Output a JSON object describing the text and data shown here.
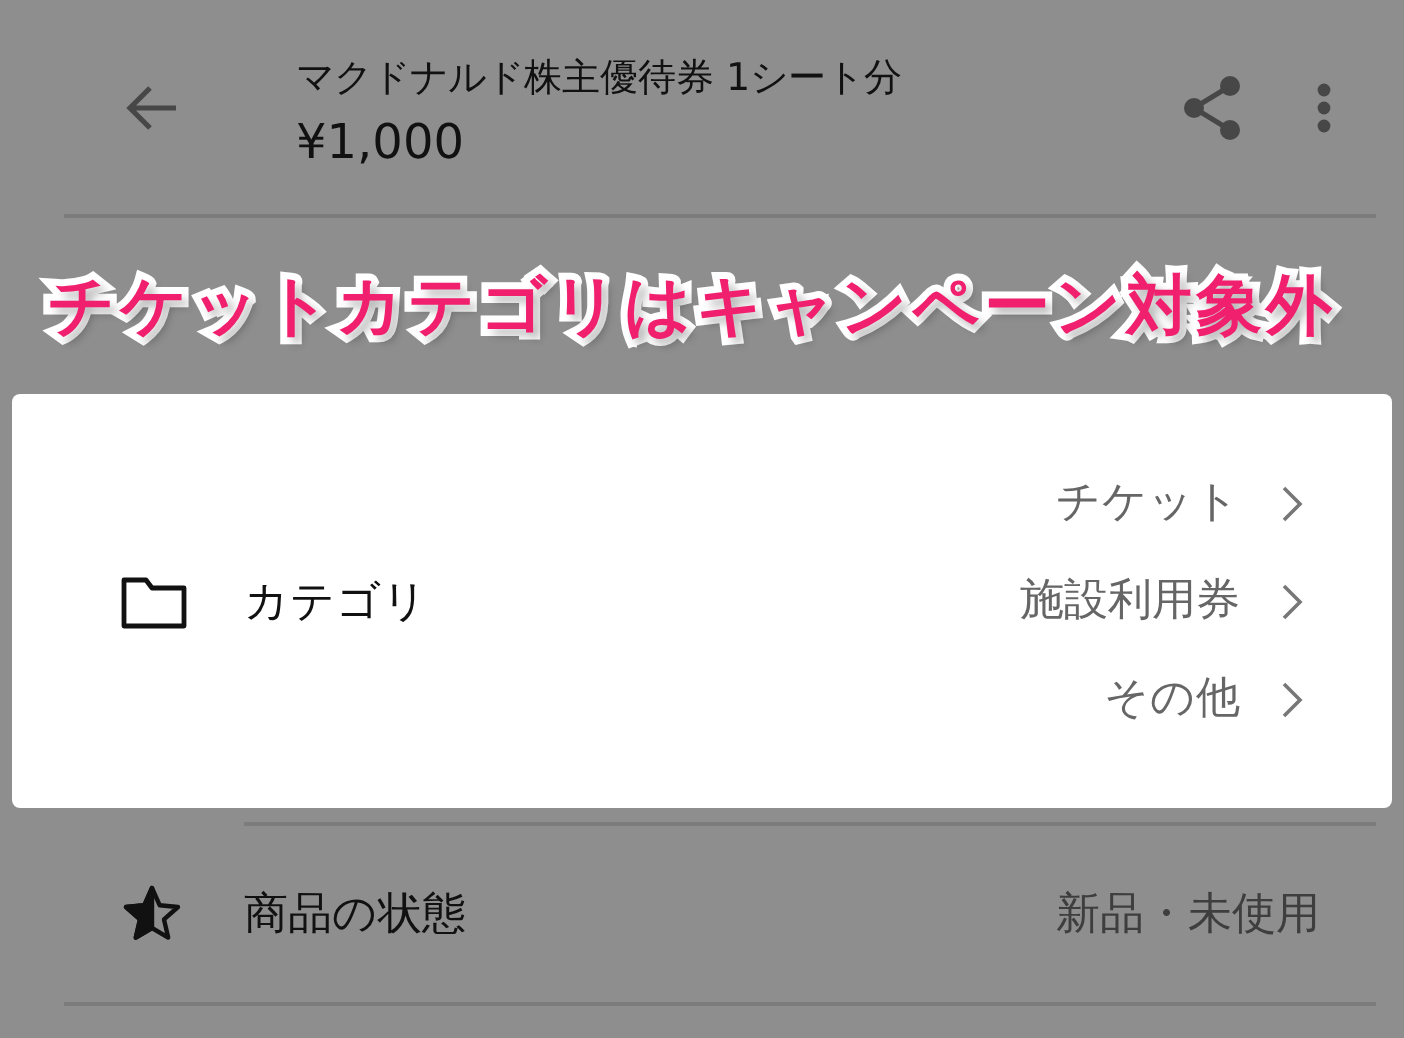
{
  "header": {
    "title": "マクドナルド株主優待券 1シート分",
    "price": "¥1,000"
  },
  "annotation": "チケットカテゴリはキャンペーン対象外",
  "category": {
    "label": "カテゴリ",
    "path": [
      "チケット",
      "施設利用券",
      "その他"
    ]
  },
  "rows": [
    {
      "label": "商品の状態",
      "value": "新品・未使用"
    }
  ]
}
